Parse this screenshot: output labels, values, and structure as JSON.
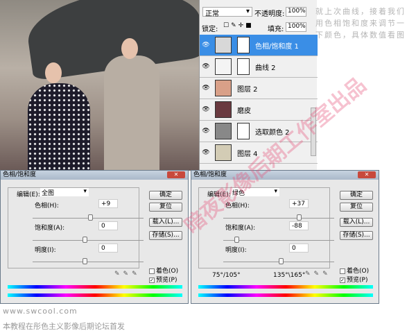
{
  "layers": {
    "blend_mode": "正常",
    "opacity_label": "不透明度:",
    "opacity": "100%",
    "lock_label": "锁定:",
    "fill_label": "填充:",
    "fill": "100%",
    "items": [
      {
        "name": "色相/饱和度 1",
        "color": "#d8d8d8",
        "selected": true,
        "mask": true
      },
      {
        "name": "曲线 2",
        "color": "#f4f4f4",
        "mask": true
      },
      {
        "name": "图层 2",
        "color": "#d9a088"
      },
      {
        "name": "磨皮",
        "color": "#6a3a40"
      },
      {
        "name": "选取颜色 2",
        "color": "#888888",
        "mask": true
      },
      {
        "name": "图层 4",
        "color": "#d3ccb5"
      }
    ]
  },
  "side_text": [
    "就上次曲线，接着我们",
    "用色相饱和度来调节一",
    "下颜色，具体数值看图"
  ],
  "dialogs": [
    {
      "title": "色相/饱和度",
      "edit_label": "编辑(E):",
      "edit_value": "全图",
      "hue_label": "色相(H):",
      "hue": "+9",
      "sat_label": "饱和度(A):",
      "sat": "0",
      "light_label": "明度(I):",
      "light": "0",
      "ok": "确定",
      "reset": "复位",
      "load": "载入(L)...",
      "save": "存储(S)...",
      "colorize": "着色(O)",
      "preview": "预览(P)",
      "range_left": "",
      "range_right": ""
    },
    {
      "title": "色相/饱和度",
      "edit_label": "编辑(E):",
      "edit_value": "绿色",
      "hue_label": "色相(H):",
      "hue": "+37",
      "sat_label": "饱和度(A):",
      "sat": "-88",
      "light_label": "明度(I):",
      "light": "0",
      "ok": "确定",
      "reset": "复位",
      "load": "载入(L)...",
      "save": "存储(S)...",
      "colorize": "着色(O)",
      "preview": "预览(P)",
      "range_left": "75°/105°",
      "range_right": "135°\\165°"
    }
  ],
  "footer": {
    "url": "www.swcool.com",
    "note": "本教程在彤色主义影像后期论坛首发"
  },
  "watermark": "暗夜影像后期工作室出品"
}
